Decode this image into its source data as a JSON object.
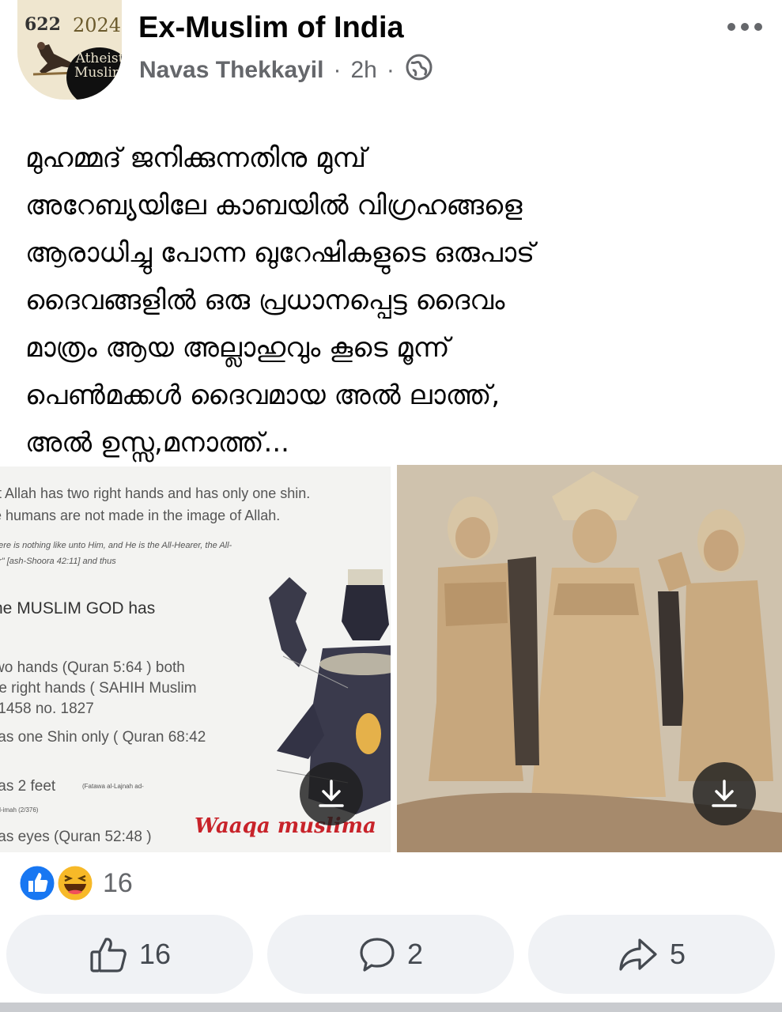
{
  "header": {
    "avatar": {
      "year_left": "622",
      "year_right": "2024",
      "badge_line1": "Atheist",
      "badge_line2": "Muslim"
    },
    "group_name": "Ex-Muslim of India",
    "author": "Navas Thekkayil",
    "separator": "·",
    "time": "2h",
    "audience_icon": "globe-icon",
    "more_icon": "more-dots-icon"
  },
  "post": {
    "text": "മുഹമ്മദ് ജനിക്കുന്നതിനു മുമ്പ്\nഅറേബ്യയിലേ കാബയിൽ  വിഗ്രഹങ്ങളെ\nആരാധിച്ചു പോന്ന ഖുറേഷികളുടെ ഒരുപാട്\nദൈവങ്ങളിൽ ഒരു പ്രധാനപ്പെട്ട ദൈവം\nമാത്രം ആയ അല്ലാഹുവും കൂടെ മൂന്ന്\nപെൺമക്കൾ ദൈവമായ അൽ ലാത്ത്,\nഅൽ ഉസ്സ,മനാത്ത്..."
  },
  "images": {
    "left": {
      "lines": [
        "ıt Allah has two right hands and has only one shin.",
        "e humans are not made in the image of Allah.",
        "here is nothing like unto Him, and He is the All-Hearer, the All-",
        "er\" [ash-Shoora 42:11] and thus",
        "he MUSLIM GOD has",
        "wo hands (Quran 5:64 ) both",
        "re right hands  ( SAHIH Muslim",
        ":1458 no. 1827",
        "Ias one Shin only ( Quran 68:42",
        "Ias 2 feet",
        "Ias  eyes (Quran 52:48 )"
      ],
      "small_note_1": "(Fatawa al-Lajnah ad-",
      "small_note_2": "ad-imah (2/376)",
      "watermark": "Waaqa muslima"
    },
    "download_icon": "download-icon"
  },
  "reactions": {
    "icons": [
      "like-reaction-icon",
      "haha-reaction-icon"
    ],
    "count": "16"
  },
  "actions": {
    "like_count": "16",
    "comment_count": "2",
    "share_count": "5"
  },
  "colors": {
    "text": "#050505",
    "secondary": "#65676b",
    "like_blue": "#1877f2",
    "button_bg": "#f0f2f5",
    "watermark_red": "#c8232a"
  }
}
